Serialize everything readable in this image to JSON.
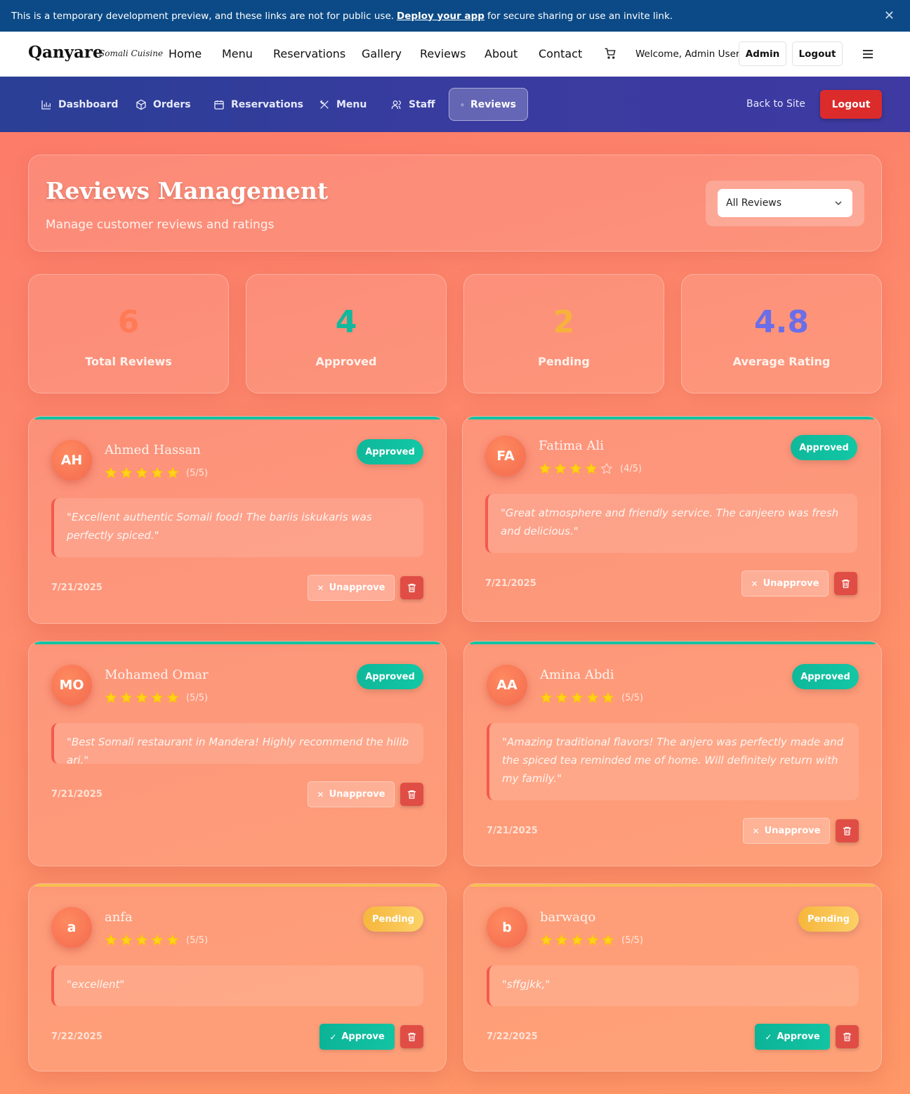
{
  "banner": {
    "text_before": "This is a temporary development preview, and these links are not for public use.",
    "link": "Deploy your app",
    "text_after": "for secure sharing or use an invite link.",
    "close_icon": "close-icon"
  },
  "site_nav": {
    "brand": "Qanyare",
    "brand_sub": "Somali Cuisine",
    "links": [
      "Home",
      "Menu",
      "Reservations",
      "Gallery",
      "Reviews",
      "About",
      "Contact"
    ],
    "cart_icon": "cart-icon",
    "welcome": "Welcome, Admin User",
    "admin_label": "Admin",
    "logout_label": "Logout",
    "menu_icon": "hamburger-icon"
  },
  "admin_nav": {
    "tabs": [
      {
        "label": "Dashboard",
        "icon": "bar-chart-icon"
      },
      {
        "label": "Orders",
        "icon": "package-icon"
      },
      {
        "label": "Reservations",
        "icon": "calendar-icon"
      },
      {
        "label": "Menu",
        "icon": "utensils-icon"
      },
      {
        "label": "Staff",
        "icon": "users-icon"
      },
      {
        "label": "Reviews",
        "icon": "star-icon",
        "active": true
      }
    ],
    "back_label": "Back to Site",
    "logout_label": "Logout"
  },
  "header": {
    "title": "Reviews Management",
    "subtitle": "Manage customer reviews and ratings",
    "filter": {
      "selected": "All Reviews",
      "icon": "chevron-down-icon"
    }
  },
  "stats": [
    {
      "value": "6",
      "label": "Total Reviews",
      "color": "#ff7a55"
    },
    {
      "value": "4",
      "label": "Approved",
      "color": "#14b89c"
    },
    {
      "value": "2",
      "label": "Pending",
      "color": "#f7b23c"
    },
    {
      "value": "4.8",
      "label": "Average Rating",
      "color": "#6b6ee8"
    }
  ],
  "reviews": [
    {
      "initials": "AH",
      "name": "Ahmed Hassan",
      "stars": 5,
      "rating": "(5/5)",
      "status": "Approved",
      "text": "\"Excellent authentic Somali food! The bariis iskukaris was perfectly spiced.\"",
      "date": "7/21/2025",
      "action": "Unapprove"
    },
    {
      "initials": "FA",
      "name": "Fatima Ali",
      "stars": 4,
      "rating": "(4/5)",
      "status": "Approved",
      "text": "\"Great atmosphere and friendly service. The canjeero was fresh and delicious.\"",
      "date": "7/21/2025",
      "action": "Unapprove"
    },
    {
      "initials": "MO",
      "name": "Mohamed Omar",
      "stars": 5,
      "rating": "(5/5)",
      "status": "Approved",
      "text": "\"Best Somali restaurant in Mandera! Highly recommend the hilib ari.\"",
      "date": "7/21/2025",
      "action": "Unapprove"
    },
    {
      "initials": "AA",
      "name": "Amina Abdi",
      "stars": 5,
      "rating": "(5/5)",
      "status": "Approved",
      "text": "\"Amazing traditional flavors! The anjero was perfectly made and the spiced tea reminded me of home. Will definitely return with my family.\"",
      "date": "7/21/2025",
      "action": "Unapprove"
    },
    {
      "initials": "a",
      "name": "anfa",
      "stars": 5,
      "rating": "(5/5)",
      "status": "Pending",
      "text": "\"excellent\"",
      "date": "7/22/2025",
      "action": "Approve"
    },
    {
      "initials": "b",
      "name": "barwaqo",
      "stars": 5,
      "rating": "(5/5)",
      "status": "Pending",
      "text": "\"sffgjkk,\"",
      "date": "7/22/2025",
      "action": "Approve"
    }
  ],
  "delete_icon": "trash-icon",
  "colors": {
    "approved": "#12c4a3",
    "pending": "#f7c050",
    "delete": "#e04d45",
    "admin_nav": "#3a3ba0",
    "banner": "#0b4a86"
  }
}
